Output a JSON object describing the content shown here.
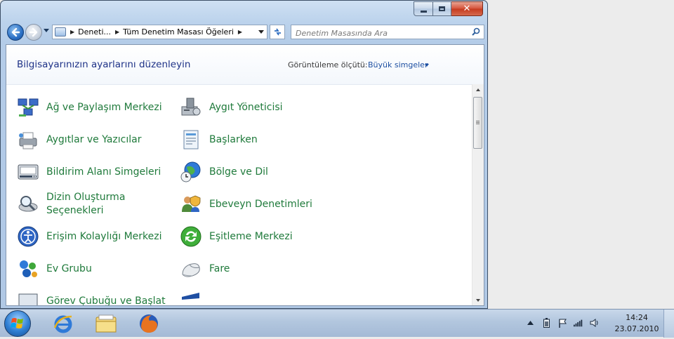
{
  "window": {
    "controls": {
      "minimize": "minimize",
      "maximize": "maximize",
      "close": "✕"
    }
  },
  "navbar": {
    "breadcrumb": [
      "Deneti...",
      "Tüm Denetim Masası Öğeleri"
    ],
    "search_placeholder": "Denetim Masasında Ara"
  },
  "header": {
    "title": "Bilgisayarınızın ayarlarını düzenleyin",
    "view_label": "Görüntüleme ölçütü:",
    "view_value": "Büyük simgeler"
  },
  "items": {
    "col1": [
      {
        "label": "Ağ ve Paylaşım Merkezi",
        "icon": "network-icon"
      },
      {
        "label": "Aygıtlar ve Yazıcılar",
        "icon": "printer-icon"
      },
      {
        "label": "Bildirim Alanı Simgeleri",
        "icon": "notification-icon"
      },
      {
        "label": "Dizin Oluşturma Seçenekleri",
        "icon": "index-icon"
      },
      {
        "label": "Erişim Kolaylığı Merkezi",
        "icon": "accessibility-icon"
      },
      {
        "label": "Ev Grubu",
        "icon": "homegroup-icon"
      },
      {
        "label": "Görev Çubuğu ve Başlat",
        "icon": "taskbar-icon"
      }
    ],
    "col2": [
      {
        "label": "Aygıt Yöneticisi",
        "icon": "device-manager-icon"
      },
      {
        "label": "Başlarken",
        "icon": "getting-started-icon"
      },
      {
        "label": "Bölge ve Dil",
        "icon": "region-icon"
      },
      {
        "label": "Ebeveyn Denetimleri",
        "icon": "parental-controls-icon"
      },
      {
        "label": "Eşitleme Merkezi",
        "icon": "sync-icon"
      },
      {
        "label": "Fare",
        "icon": "mouse-icon"
      },
      {
        "label": "",
        "icon": "partial-icon"
      }
    ]
  },
  "taskbar": {
    "pinned": [
      "internet-explorer-icon",
      "windows-explorer-icon",
      "firefox-icon"
    ],
    "tray": [
      "show-hidden-icons",
      "battery-icon",
      "action-center-flag-icon",
      "network-signal-icon",
      "volume-icon"
    ],
    "time": "14:24",
    "date": "23.07.2010"
  },
  "colors": {
    "link_green": "#1f7a3b",
    "title_blue": "#1e3287",
    "accent_blue": "#1e50a2"
  }
}
